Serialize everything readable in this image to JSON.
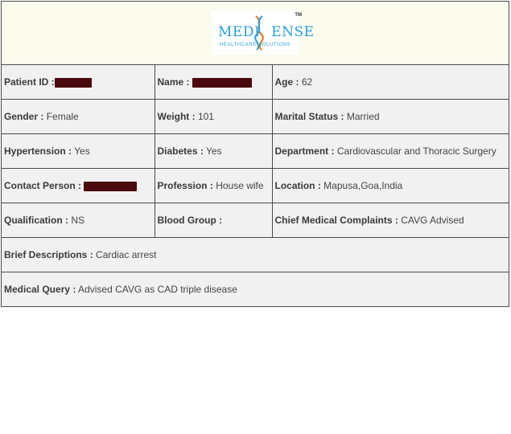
{
  "header": {
    "logo": {
      "brand_text": "MEDISENSE",
      "brand_left": "MEDI",
      "brand_right": "ENSE",
      "tagline": "HEALTHCARE SOLUTIONS",
      "trademark": "TM",
      "colors": {
        "brand": "#2a9ed8",
        "helix_accent": "#e3741c"
      }
    }
  },
  "fields": {
    "patient_id": {
      "label": "Patient ID :",
      "value": "",
      "redacted": true
    },
    "name": {
      "label": "Name :",
      "value": "",
      "redacted": true
    },
    "age": {
      "label": "Age :",
      "value": "62"
    },
    "gender": {
      "label": "Gender :",
      "value": "Female"
    },
    "weight": {
      "label": "Weight :",
      "value": "101"
    },
    "marital_status": {
      "label": "Marital Status :",
      "value": "Married"
    },
    "hypertension": {
      "label": "Hypertension :",
      "value": "Yes"
    },
    "diabetes": {
      "label": "Diabetes :",
      "value": "Yes"
    },
    "department": {
      "label": "Department :",
      "value": "Cardiovascular and Thoracic Surgery"
    },
    "contact_person": {
      "label": "Contact Person :",
      "value": "",
      "redacted": true
    },
    "profession": {
      "label": "Profession :",
      "value": "House wife"
    },
    "location": {
      "label": "Location :",
      "value": "Mapusa,Goa,India"
    },
    "qualification": {
      "label": "Qualification :",
      "value": "NS"
    },
    "blood_group": {
      "label": "Blood Group :",
      "value": ""
    },
    "chief_complaints": {
      "label": "Chief Medical Complaints :",
      "value": "CAVG Advised"
    },
    "brief_descriptions": {
      "label": "Brief Descriptions :",
      "value": "Cardiac arrest"
    },
    "medical_query": {
      "label": "Medical Query :",
      "value": "Advised CAVG as CAD triple disease"
    }
  },
  "colors": {
    "cell_background": "#f1f1f1",
    "header_background": "#fbfbee",
    "border": "#4a4a4a",
    "redaction": "#4a0a0e"
  }
}
